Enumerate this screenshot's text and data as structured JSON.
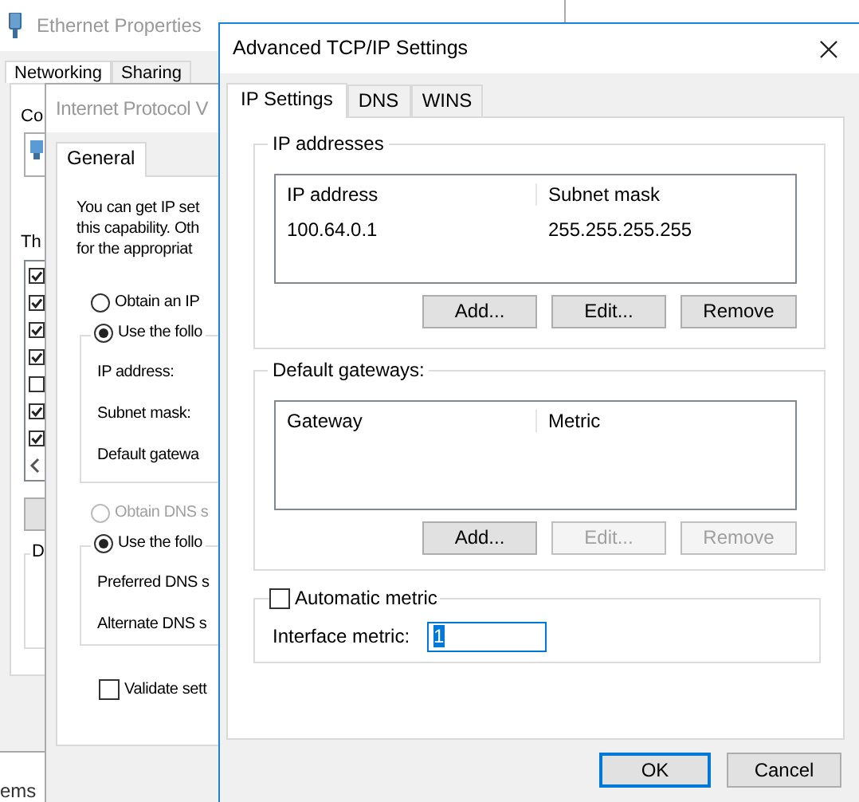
{
  "ethernet_window": {
    "title": "Ethernet Properties",
    "tabs": [
      {
        "label": "Networking",
        "selected": true
      },
      {
        "label": "Sharing",
        "selected": false
      }
    ],
    "connect_label": "Co",
    "components_label": "Th",
    "components": [
      {
        "checked": true
      },
      {
        "checked": true
      },
      {
        "checked": true
      },
      {
        "checked": true
      },
      {
        "checked": false
      },
      {
        "checked": true
      },
      {
        "checked": true
      }
    ],
    "group_label": "D"
  },
  "background_window": {
    "status_text": "ems"
  },
  "ipv4_window": {
    "title": "Internet Protocol V",
    "tabs": [
      {
        "label": "General",
        "selected": true
      }
    ],
    "intro": "You can get IP set\nthis capability. Oth\nfor the appropriat",
    "ip_options": [
      {
        "label": "Obtain an IP",
        "selected": false,
        "disabled": false
      },
      {
        "label": "Use the follo",
        "selected": true,
        "disabled": false
      }
    ],
    "ip_fields": [
      "IP address:",
      "Subnet mask:",
      "Default gatewa"
    ],
    "dns_options": [
      {
        "label": "Obtain DNS s",
        "selected": false,
        "disabled": true
      },
      {
        "label": "Use the follo",
        "selected": true,
        "disabled": false
      }
    ],
    "dns_fields": [
      "Preferred DNS s",
      "Alternate DNS s"
    ],
    "validate": {
      "label": "Validate sett",
      "checked": false
    }
  },
  "advanced_window": {
    "title": "Advanced TCP/IP Settings",
    "tabs": [
      {
        "label": "IP Settings",
        "selected": true
      },
      {
        "label": "DNS",
        "selected": false
      },
      {
        "label": "WINS",
        "selected": false
      }
    ],
    "groups": [
      {
        "title": "IP addresses",
        "columns": [
          "IP address",
          "Subnet mask"
        ],
        "rows": [
          [
            "100.64.0.1",
            "255.255.255.255"
          ]
        ],
        "buttons": [
          {
            "label": "Add...",
            "disabled": false
          },
          {
            "label": "Edit...",
            "disabled": false
          },
          {
            "label": "Remove",
            "disabled": false
          }
        ]
      },
      {
        "title": "Default gateways:",
        "columns": [
          "Gateway",
          "Metric"
        ],
        "buttons": [
          {
            "label": "Add...",
            "disabled": false
          },
          {
            "label": "Edit...",
            "disabled": true
          },
          {
            "label": "Remove",
            "disabled": true
          }
        ]
      }
    ],
    "metric": {
      "automatic": {
        "label": "Automatic metric",
        "checked": false
      },
      "interface_label": "Interface metric:",
      "interface_value": "1",
      "value_selected": true
    },
    "buttons": [
      {
        "label": "OK",
        "default": true
      },
      {
        "label": "Cancel",
        "default": false
      }
    ]
  }
}
